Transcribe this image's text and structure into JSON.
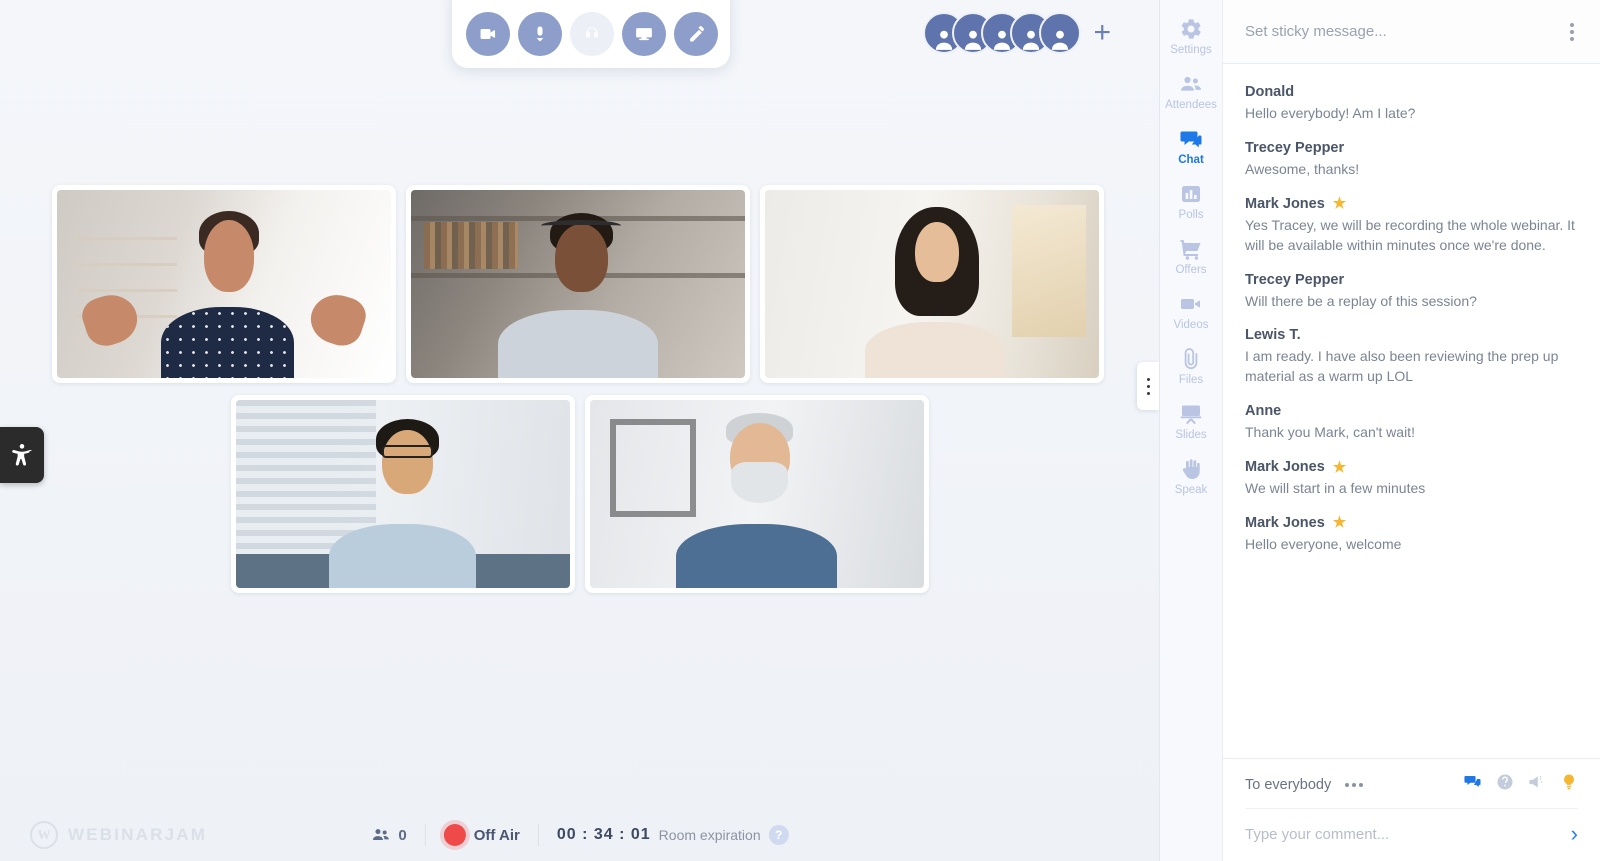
{
  "toolbar": {
    "buttons": [
      {
        "name": "camera-button",
        "icon": "video-camera-icon",
        "state": "active"
      },
      {
        "name": "microphone-button",
        "icon": "microphone-icon",
        "state": "active"
      },
      {
        "name": "headphones-button",
        "icon": "headphones-icon",
        "state": "disabled"
      },
      {
        "name": "screenshare-button",
        "icon": "monitor-icon",
        "state": "active"
      },
      {
        "name": "whiteboard-button",
        "icon": "pencil-icon",
        "state": "active"
      }
    ]
  },
  "avatars": {
    "count": 5,
    "add_label": "+"
  },
  "stage": {
    "tiles": [
      {
        "name": "video-tile-1",
        "person": "presenter-woman-gesturing"
      },
      {
        "name": "video-tile-2",
        "person": "man-with-headset"
      },
      {
        "name": "video-tile-3",
        "person": "woman-long-hair"
      },
      {
        "name": "video-tile-4",
        "person": "man-with-glasses"
      },
      {
        "name": "video-tile-5",
        "person": "older-man-beard"
      }
    ]
  },
  "bottom_bar": {
    "brand_mark": "W",
    "brand_name": "WEBINARJAM",
    "attendee_count": "0",
    "broadcast_status": "Off Air",
    "timer": "00 : 34 : 01",
    "room_expiration_label": "Room expiration",
    "help_glyph": "?",
    "status_color": "#ef4a4a"
  },
  "rail": {
    "items": [
      {
        "label": "Settings",
        "icon": "gear-icon",
        "active": false
      },
      {
        "label": "Attendees",
        "icon": "people-icon",
        "active": false
      },
      {
        "label": "Chat",
        "icon": "chat-icon",
        "active": true
      },
      {
        "label": "Polls",
        "icon": "bar-chart-icon",
        "active": false
      },
      {
        "label": "Offers",
        "icon": "cart-icon",
        "active": false
      },
      {
        "label": "Videos",
        "icon": "video-icon",
        "active": false
      },
      {
        "label": "Files",
        "icon": "paperclip-icon",
        "active": false
      },
      {
        "label": "Slides",
        "icon": "presentation-icon",
        "active": false
      },
      {
        "label": "Speak",
        "icon": "hand-icon",
        "active": false
      }
    ],
    "active_color": "#1e78e8",
    "inactive_color": "#b9c5e2"
  },
  "chat": {
    "sticky_placeholder": "Set sticky message...",
    "messages": [
      {
        "author": "Donald",
        "host": false,
        "text": "Hello everybody! Am I late?"
      },
      {
        "author": "Trecey Pepper",
        "host": false,
        "text": "Awesome, thanks!"
      },
      {
        "author": "Mark Jones",
        "host": true,
        "text": "Yes Tracey, we will be recording the whole webinar. It will be available within minutes once we're done."
      },
      {
        "author": "Trecey Pepper",
        "host": false,
        "text": "Will there be a replay of this session?"
      },
      {
        "author": "Lewis T.",
        "host": false,
        "text": "I am ready. I have also been reviewing the prep up material as a warm up LOL"
      },
      {
        "author": "Anne",
        "host": false,
        "text": "Thank you Mark, can't wait!"
      },
      {
        "author": "Mark Jones",
        "host": true,
        "text": "We will start in a few minutes"
      },
      {
        "author": "Mark Jones",
        "host": true,
        "text": "Hello everyone, welcome"
      }
    ],
    "host_star": "★",
    "compose": {
      "recipient_label": "To everybody",
      "input_placeholder": "Type your comment...",
      "send_glyph": "›",
      "icons": [
        {
          "name": "chat-mode-icon",
          "state": "active"
        },
        {
          "name": "question-mode-icon",
          "state": "inactive"
        },
        {
          "name": "announcement-icon",
          "state": "inactive"
        },
        {
          "name": "highlight-bulb-icon",
          "state": "inactive"
        }
      ]
    }
  },
  "accessibility": {
    "label": "accessibility-icon"
  }
}
